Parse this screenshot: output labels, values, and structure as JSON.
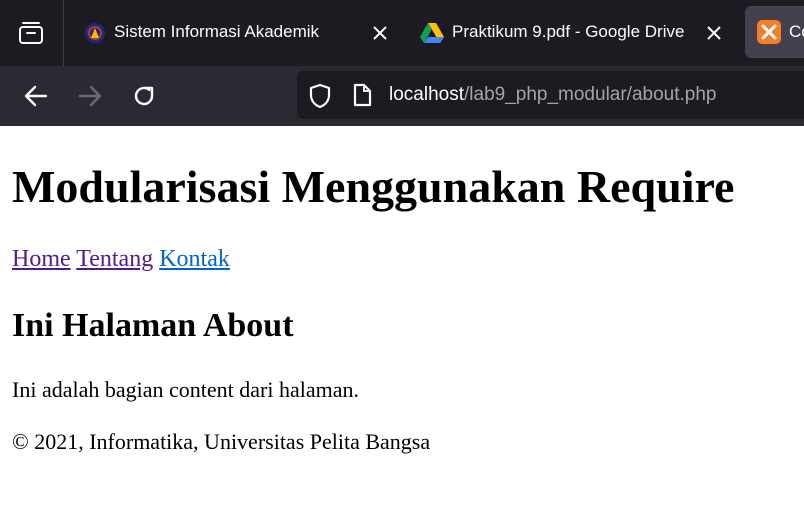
{
  "browser": {
    "tabs": [
      {
        "title": "Sistem Informasi Akademik",
        "icon": "campus-logo-icon",
        "active": false
      },
      {
        "title": "Praktikum 9.pdf - Google Drive",
        "icon": "google-drive-icon",
        "active": false
      },
      {
        "title": "Co",
        "icon": "xampp-icon",
        "active": true
      }
    ],
    "close_label": "✕",
    "url": {
      "host": "localhost",
      "path": "/lab9_php_modular/about.php"
    },
    "colors": {
      "tabbar": "#1c1b22",
      "toolbar": "#2b2a33",
      "urlbar": "#1c1b22"
    }
  },
  "page": {
    "heading": "Modularisasi Menggunakan Require",
    "menu": [
      {
        "label": "Home",
        "visited": true
      },
      {
        "label": "Tentang",
        "visited": true
      },
      {
        "label": "Kontak",
        "visited": false
      }
    ],
    "subheading": "Ini Halaman About",
    "content": "Ini adalah bagian content dari halaman.",
    "footer": "© 2021, Informatika, Universitas Pelita Bangsa"
  }
}
